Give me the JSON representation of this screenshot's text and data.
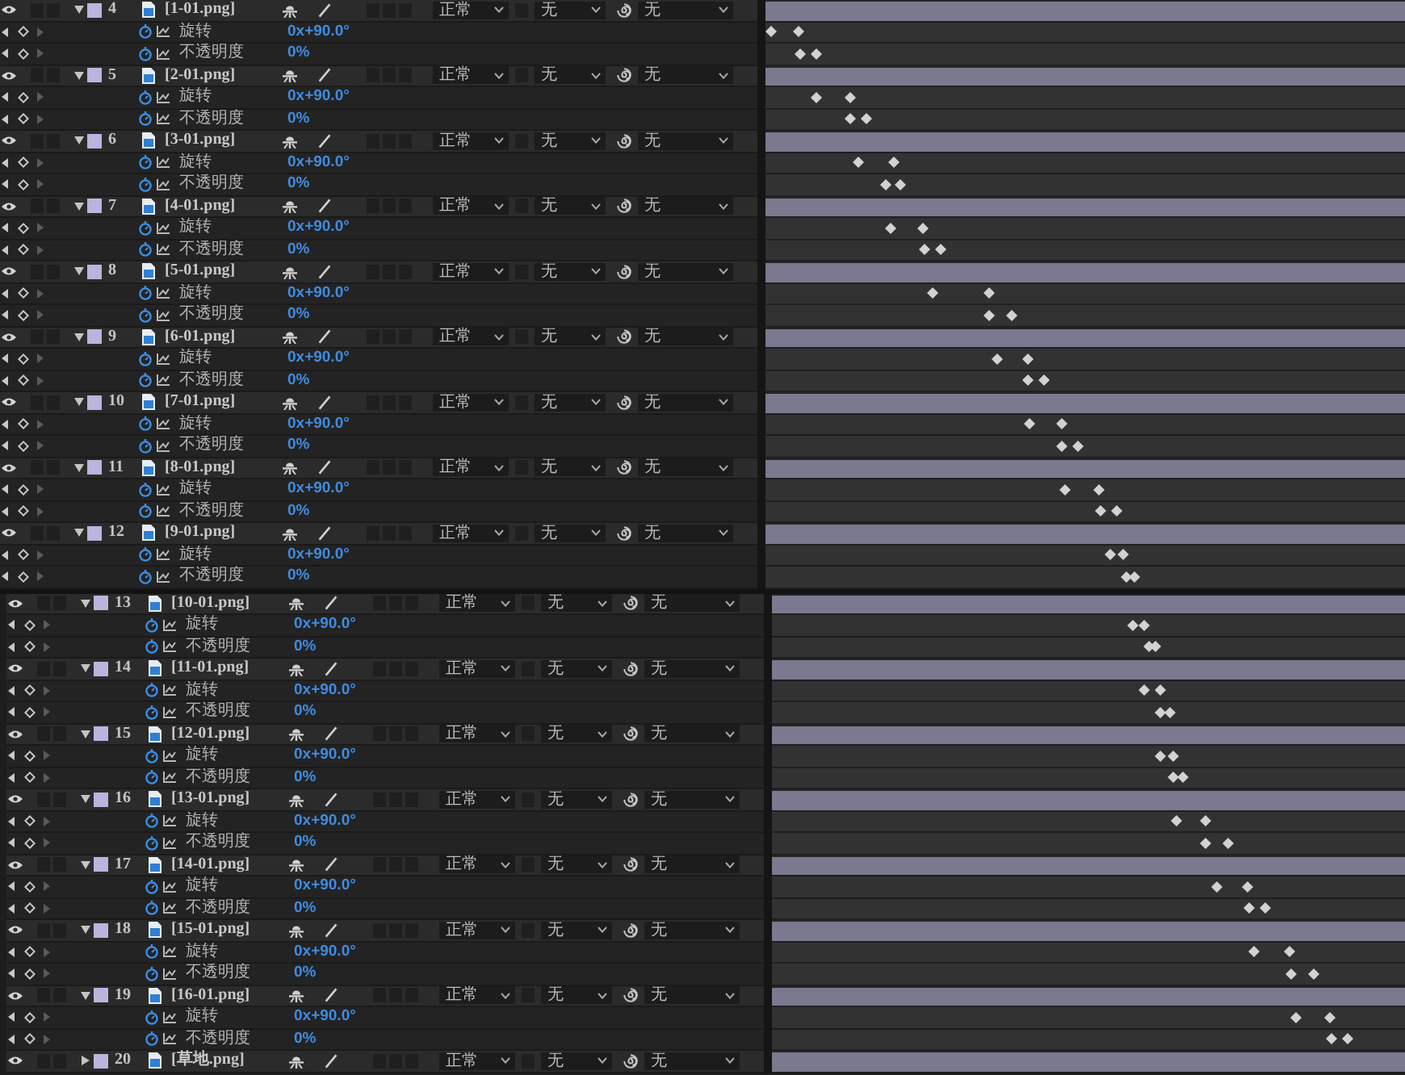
{
  "panels": [
    {
      "layers": [
        {
          "number": "4",
          "switches": [
            {
              "on": false
            },
            {
              "on": false
            },
            {
              "on": false
            },
            {
              "on": false
            },
            {
              "on": false
            },
            {
              "on": false
            }
          ],
          "name": "[1-01.png]",
          "expanded": true,
          "mode": "正常",
          "track_matte": "无",
          "parent": "无",
          "properties": [
            {
              "name": "旋转",
              "value": "0x+90.0°"
            },
            {
              "name": "不透明度",
              "value": "0%"
            }
          ]
        },
        {
          "number": "5",
          "switches": [
            {
              "on": false
            },
            {
              "on": false
            },
            {
              "on": false
            },
            {
              "on": false
            },
            {
              "on": false
            },
            {
              "on": false
            }
          ],
          "name": "[2-01.png]",
          "expanded": true,
          "mode": "正常",
          "track_matte": "无",
          "parent": "无",
          "properties": [
            {
              "name": "旋转",
              "value": "0x+90.0°"
            },
            {
              "name": "不透明度",
              "value": "0%"
            }
          ]
        },
        {
          "number": "6",
          "switches": [
            {
              "on": false
            },
            {
              "on": false
            },
            {
              "on": false
            },
            {
              "on": false
            },
            {
              "on": false
            },
            {
              "on": false
            }
          ],
          "name": "[3-01.png]",
          "expanded": true,
          "mode": "正常",
          "track_matte": "无",
          "parent": "无",
          "properties": [
            {
              "name": "旋转",
              "value": "0x+90.0°"
            },
            {
              "name": "不透明度",
              "value": "0%"
            }
          ]
        },
        {
          "number": "7",
          "switches": [
            {
              "on": false
            },
            {
              "on": false
            },
            {
              "on": false
            },
            {
              "on": false
            },
            {
              "on": false
            },
            {
              "on": false
            }
          ],
          "name": "[4-01.png]",
          "expanded": true,
          "mode": "正常",
          "track_matte": "无",
          "parent": "无",
          "properties": [
            {
              "name": "旋转",
              "value": "0x+90.0°"
            },
            {
              "name": "不透明度",
              "value": "0%"
            }
          ]
        },
        {
          "number": "8",
          "switches": [
            {
              "on": false
            },
            {
              "on": false
            },
            {
              "on": false
            },
            {
              "on": false
            },
            {
              "on": false
            },
            {
              "on": false
            }
          ],
          "name": "[5-01.png]",
          "expanded": true,
          "mode": "正常",
          "track_matte": "无",
          "parent": "无",
          "properties": [
            {
              "name": "旋转",
              "value": "0x+90.0°"
            },
            {
              "name": "不透明度",
              "value": "0%"
            }
          ]
        },
        {
          "number": "9",
          "switches": [
            {
              "on": false
            },
            {
              "on": false
            },
            {
              "on": false
            },
            {
              "on": false
            },
            {
              "on": false
            },
            {
              "on": false
            }
          ],
          "name": "[6-01.png]",
          "expanded": true,
          "mode": "正常",
          "track_matte": "无",
          "parent": "无",
          "properties": [
            {
              "name": "旋转",
              "value": "0x+90.0°"
            },
            {
              "name": "不透明度",
              "value": "0%"
            }
          ]
        },
        {
          "number": "10",
          "switches": [
            {
              "on": false
            },
            {
              "on": false
            },
            {
              "on": false
            },
            {
              "on": false
            },
            {
              "on": false
            },
            {
              "on": false
            }
          ],
          "name": "[7-01.png]",
          "expanded": true,
          "mode": "正常",
          "track_matte": "无",
          "parent": "无",
          "properties": [
            {
              "name": "旋转",
              "value": "0x+90.0°"
            },
            {
              "name": "不透明度",
              "value": "0%"
            }
          ]
        },
        {
          "number": "11",
          "switches": [
            {
              "on": false
            },
            {
              "on": false
            },
            {
              "on": false
            },
            {
              "on": false
            },
            {
              "on": false
            },
            {
              "on": false
            }
          ],
          "name": "[8-01.png]",
          "expanded": true,
          "mode": "正常",
          "track_matte": "无",
          "parent": "无",
          "properties": [
            {
              "name": "旋转",
              "value": "0x+90.0°"
            },
            {
              "name": "不透明度",
              "value": "0%"
            }
          ]
        },
        {
          "number": "12",
          "switches": [
            {
              "on": false
            },
            {
              "on": false
            },
            {
              "on": false
            },
            {
              "on": false
            },
            {
              "on": false
            },
            {
              "on": false
            }
          ],
          "name": "[9-01.png]",
          "expanded": true,
          "mode": "正常",
          "track_matte": "无",
          "parent": "无",
          "properties": [
            {
              "name": "旋转",
              "value": "0x+90.0°"
            },
            {
              "name": "不透明度",
              "value": "0%"
            }
          ]
        }
      ]
    },
    {
      "layers": [
        {
          "number": "13",
          "switches": [
            {
              "on": false
            },
            {
              "on": false
            },
            {
              "on": false
            },
            {
              "on": false
            },
            {
              "on": false
            },
            {
              "on": false
            }
          ],
          "name": "[10-01.png]",
          "expanded": true,
          "mode": "正常",
          "track_matte": "无",
          "parent": "无",
          "properties": [
            {
              "name": "旋转",
              "value": "0x+90.0°"
            },
            {
              "name": "不透明度",
              "value": "0%"
            }
          ]
        },
        {
          "number": "14",
          "switches": [
            {
              "on": false
            },
            {
              "on": false
            },
            {
              "on": false
            },
            {
              "on": false
            },
            {
              "on": false
            },
            {
              "on": false
            }
          ],
          "name": "[11-01.png]",
          "expanded": true,
          "mode": "正常",
          "track_matte": "无",
          "parent": "无",
          "properties": [
            {
              "name": "旋转",
              "value": "0x+90.0°"
            },
            {
              "name": "不透明度",
              "value": "0%"
            }
          ]
        },
        {
          "number": "15",
          "switches": [
            {
              "on": false
            },
            {
              "on": false
            },
            {
              "on": false
            },
            {
              "on": false
            },
            {
              "on": false
            },
            {
              "on": false
            }
          ],
          "name": "[12-01.png]",
          "expanded": true,
          "mode": "正常",
          "track_matte": "无",
          "parent": "无",
          "properties": [
            {
              "name": "旋转",
              "value": "0x+90.0°"
            },
            {
              "name": "不透明度",
              "value": "0%"
            }
          ]
        },
        {
          "number": "16",
          "switches": [
            {
              "on": false
            },
            {
              "on": false
            },
            {
              "on": false
            },
            {
              "on": false
            },
            {
              "on": false
            },
            {
              "on": false
            }
          ],
          "name": "[13-01.png]",
          "expanded": true,
          "mode": "正常",
          "track_matte": "无",
          "parent": "无",
          "properties": [
            {
              "name": "旋转",
              "value": "0x+90.0°"
            },
            {
              "name": "不透明度",
              "value": "0%"
            }
          ]
        },
        {
          "number": "17",
          "switches": [
            {
              "on": false
            },
            {
              "on": false
            },
            {
              "on": false
            },
            {
              "on": false
            },
            {
              "on": false
            },
            {
              "on": false
            }
          ],
          "name": "[14-01.png]",
          "expanded": true,
          "mode": "正常",
          "track_matte": "无",
          "parent": "无",
          "properties": [
            {
              "name": "旋转",
              "value": "0x+90.0°"
            },
            {
              "name": "不透明度",
              "value": "0%"
            }
          ]
        },
        {
          "number": "18",
          "switches": [
            {
              "on": false
            },
            {
              "on": false
            },
            {
              "on": false
            },
            {
              "on": false
            },
            {
              "on": false
            },
            {
              "on": false
            }
          ],
          "name": "[15-01.png]",
          "expanded": true,
          "mode": "正常",
          "track_matte": "无",
          "parent": "无",
          "properties": [
            {
              "name": "旋转",
              "value": "0x+90.0°"
            },
            {
              "name": "不透明度",
              "value": "0%"
            }
          ]
        },
        {
          "number": "19",
          "switches": [
            {
              "on": false
            },
            {
              "on": false
            },
            {
              "on": false
            },
            {
              "on": false
            },
            {
              "on": false
            },
            {
              "on": false
            }
          ],
          "name": "[16-01.png]",
          "expanded": true,
          "mode": "正常",
          "track_matte": "无",
          "parent": "无",
          "properties": [
            {
              "name": "旋转",
              "value": "0x+90.0°"
            },
            {
              "name": "不透明度",
              "value": "0%"
            }
          ]
        },
        {
          "number": "20",
          "switches": [
            {
              "on": false
            },
            {
              "on": false
            },
            {
              "on": false
            },
            {
              "on": false
            },
            {
              "on": false
            },
            {
              "on": false
            }
          ],
          "name": "[草地.png]",
          "expanded": false,
          "mode": "正常",
          "track_matte": "无",
          "parent": "无"
        }
      ]
    }
  ]
}
